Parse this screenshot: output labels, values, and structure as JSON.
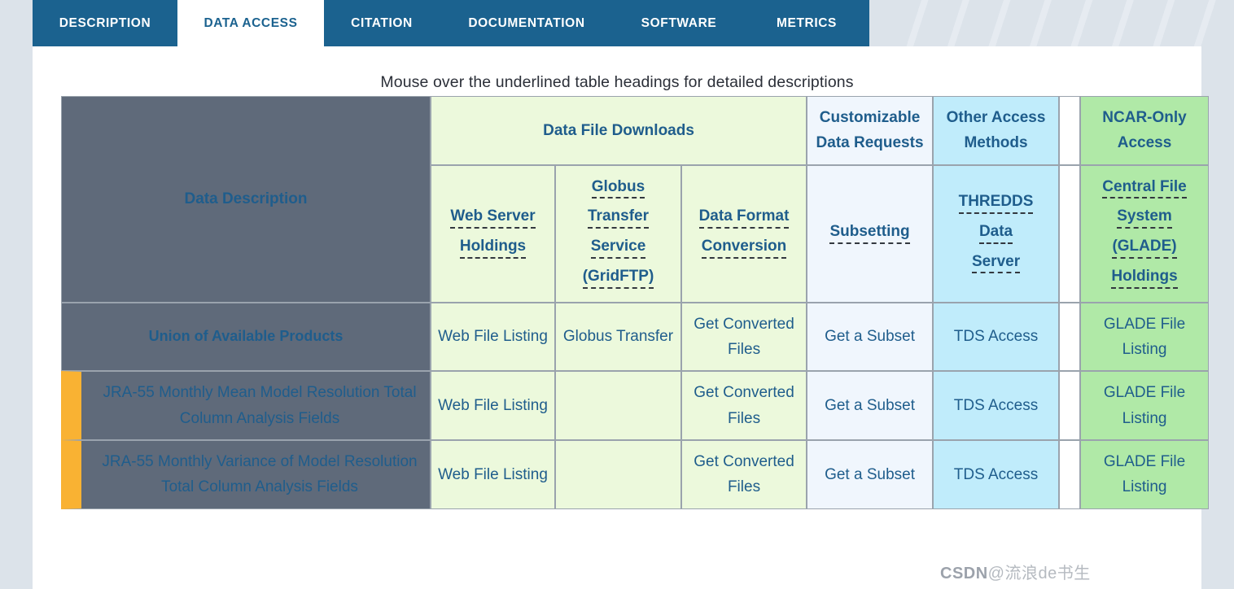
{
  "tabs": [
    {
      "label": "DESCRIPTION",
      "active": false
    },
    {
      "label": "DATA ACCESS",
      "active": true
    },
    {
      "label": "CITATION",
      "active": false
    },
    {
      "label": "DOCUMENTATION",
      "active": false
    },
    {
      "label": "SOFTWARE",
      "active": false
    },
    {
      "label": "METRICS",
      "active": false
    }
  ],
  "caption": "Mouse over the underlined table headings for detailed descriptions",
  "table": {
    "group_headers": {
      "data_description": "Data Description",
      "data_file_downloads": "Data File Downloads",
      "customizable_data_requests": "Customizable Data Requests",
      "other_access_methods": "Other Access Methods",
      "ncar_only_access": "NCAR-Only Access"
    },
    "sub_headers": {
      "web_server_holdings": [
        "Web Server",
        "Holdings"
      ],
      "globus_transfer": [
        "Globus",
        "Transfer",
        "Service",
        "(GridFTP)"
      ],
      "data_format_conversion": [
        "Data Format",
        "Conversion"
      ],
      "subsetting": [
        "Subsetting"
      ],
      "thredds": [
        "THREDDS",
        "Data",
        "Server"
      ],
      "central_file_system": [
        "Central File",
        "System",
        "(GLADE)",
        "Holdings"
      ]
    },
    "rows": [
      {
        "description": "Union of Available Products",
        "is_union": true,
        "accent": false,
        "web_server": "Web File Listing",
        "globus": "Globus Transfer",
        "format_conversion": "Get Converted Files",
        "subsetting": "Get a Subset",
        "thredds": "TDS Access",
        "glade": "GLADE File Listing"
      },
      {
        "description": "JRA-55 Monthly Mean Model Resolution Total Column Analysis Fields",
        "is_union": false,
        "accent": true,
        "web_server": "Web File Listing",
        "globus": "",
        "format_conversion": "Get Converted Files",
        "subsetting": "Get a Subset",
        "thredds": "TDS Access",
        "glade": "GLADE File Listing"
      },
      {
        "description": "JRA-55 Monthly Variance of Model Resolution Total Column Analysis Fields",
        "is_union": false,
        "accent": true,
        "web_server": "Web File Listing",
        "globus": "",
        "format_conversion": "Get Converted Files",
        "subsetting": "Get a Subset",
        "thredds": "TDS Access",
        "glade": "GLADE File Listing"
      }
    ]
  },
  "watermark": {
    "prefix": "CSDN",
    "handle": "@流浪de书生"
  },
  "colors": {
    "tab_blue": "#1b628f",
    "page_bg": "#dce3ea",
    "header_dark": "#5f6a7a",
    "green": "#ecf9dc",
    "ice": "#f0f6fd",
    "cyan": "#c0ecfb",
    "ncar_green": "#b0e9a7",
    "accent_orange": "#f9b233",
    "link_text": "#1f5d8c"
  }
}
